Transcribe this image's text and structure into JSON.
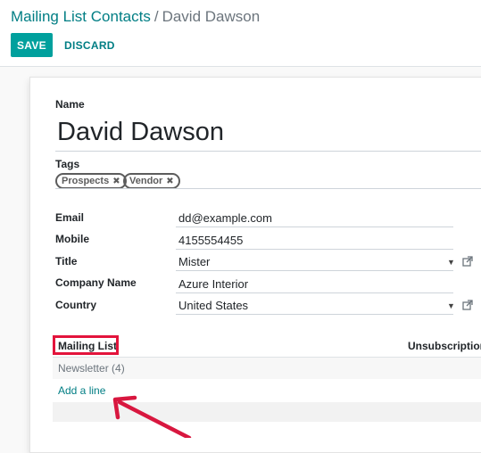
{
  "breadcrumb": {
    "parent": "Mailing List Contacts",
    "separator": "/",
    "current": "David Dawson"
  },
  "toolbar": {
    "save_label": "SAVE",
    "discard_label": "DISCARD"
  },
  "form": {
    "name_label": "Name",
    "name_value": "David Dawson",
    "tags_label": "Tags",
    "tags": [
      "Prospects",
      "Vendor"
    ],
    "fields": [
      {
        "label": "Email",
        "value": "dd@example.com"
      },
      {
        "label": "Mobile",
        "value": "4155554455"
      },
      {
        "label": "Title",
        "value": "Mister"
      },
      {
        "label": "Company Name",
        "value": "Azure Interior"
      },
      {
        "label": "Country",
        "value": "United States"
      }
    ]
  },
  "subscriptions": {
    "column_mailing_list": "Mailing List",
    "column_unsubscription": "Unsubscription",
    "rows": [
      "Newsletter (4)"
    ],
    "add_line_label": "Add a line"
  },
  "colors": {
    "brand": "#017e84",
    "save_button": "#00a09d",
    "highlight": "#e3143c",
    "arrow": "#d8173f"
  },
  "icons": {
    "tag_remove": "close-icon",
    "dropdown": "caret-down-icon",
    "external_link": "external-link-icon",
    "annotation_arrow": "arrow-icon"
  }
}
